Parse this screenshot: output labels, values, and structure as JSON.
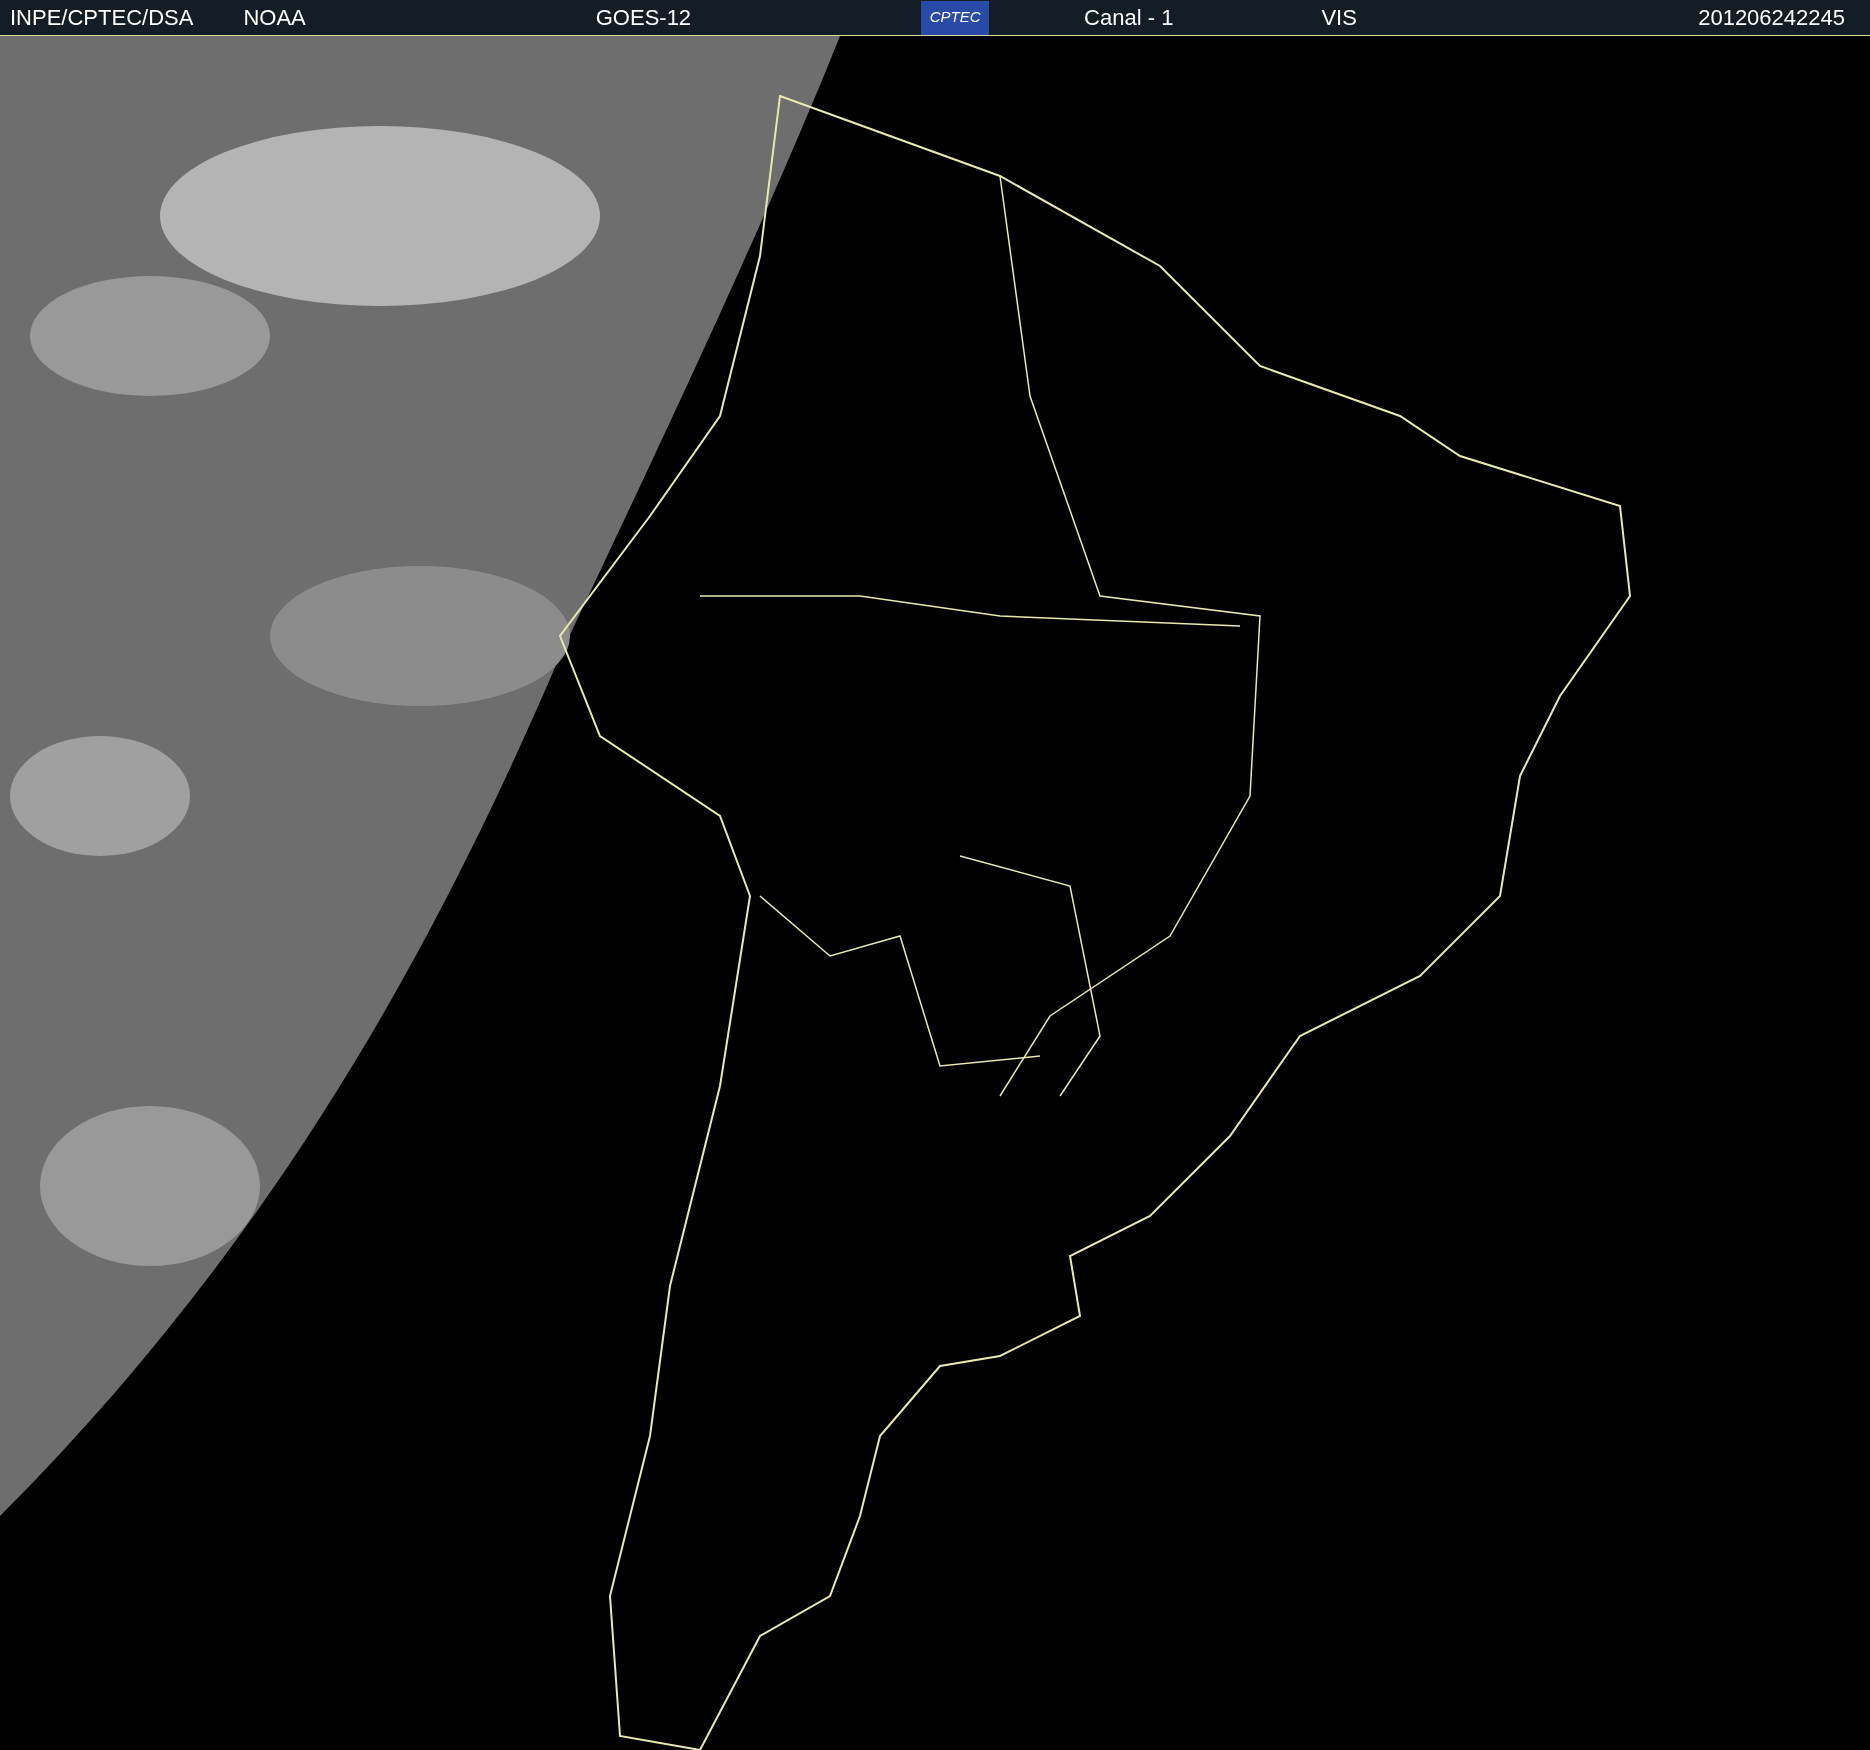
{
  "header": {
    "source": "INPE/CPTEC/DSA",
    "agency": "NOAA",
    "satellite": "GOES-12",
    "logo": "CPTEC",
    "channel": "Canal - 1",
    "band": "VIS",
    "timestamp": "201206242245"
  }
}
